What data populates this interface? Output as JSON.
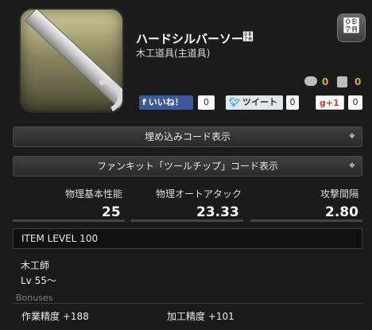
{
  "item": {
    "name": "ハードシルバーソー",
    "category": "木工道具(主道具)",
    "title_mark": "୺"
  },
  "counts": {
    "comments": "0",
    "pins": "0"
  },
  "social": {
    "facebook_label": "いいね！",
    "facebook_count": "0",
    "twitter_label": "ツイート",
    "twitter_count": "0",
    "googleplus_label": "+1",
    "googleplus_count": "0"
  },
  "code_bars": {
    "embed_label": "埋め込みコード表示",
    "fankit_label": "ファンキット「ツールチップ」コード表示",
    "chevron": "❖"
  },
  "stats": [
    {
      "label": "物理基本性能",
      "value": "25"
    },
    {
      "label": "物理オートアタック",
      "value": "23.33"
    },
    {
      "label": "攻撃間隔",
      "value": "2.80"
    }
  ],
  "item_level": "ITEM LEVEL 100",
  "requirements": {
    "job": "木工師",
    "level": "Lv 55〜"
  },
  "bonuses": {
    "heading": "Bonuses",
    "items": [
      {
        "text": "作業精度 +188"
      },
      {
        "text": "加工精度 +101"
      }
    ]
  },
  "icons": {
    "logo": "lodestone-logo-icon",
    "comment": "comment-icon",
    "pin": "pin-icon"
  }
}
